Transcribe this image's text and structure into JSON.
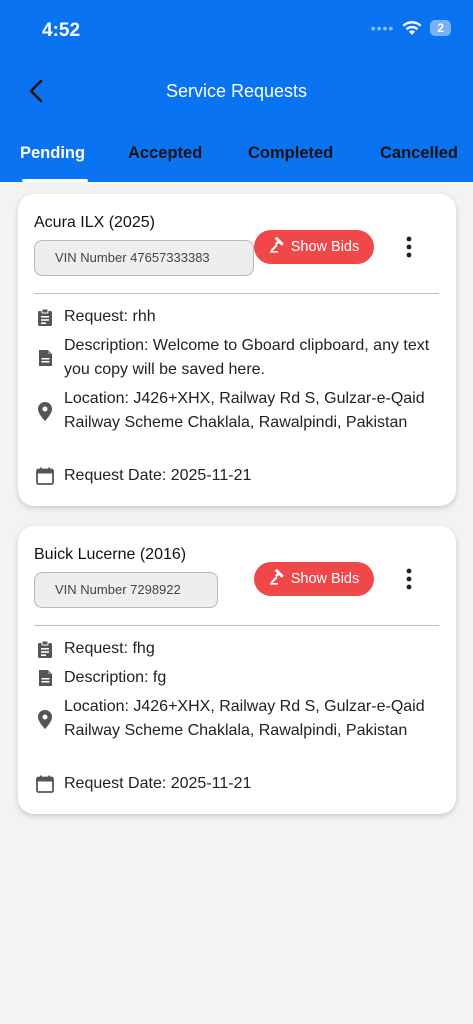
{
  "status_bar": {
    "time": "4:52",
    "signal": "••••",
    "battery": "2"
  },
  "header": {
    "title": "Service Requests"
  },
  "tabs": [
    {
      "label": "Pending"
    },
    {
      "label": "Accepted"
    },
    {
      "label": "Completed"
    },
    {
      "label": "Cancelled"
    }
  ],
  "cards": [
    {
      "car": "Acura ILX (2025)",
      "vin": "VIN Number 47657333383",
      "bids_label": "Show Bids",
      "request": "Request: rhh",
      "description": "Description: Welcome to Gboard clipboard, any text you copy will be saved here.",
      "location": "Location: J426+XHX, Railway Rd S, Gulzar-e-Qaid Railway Scheme Chaklala, Rawalpindi, Pakistan",
      "date": "Request Date: 2025-11-21"
    },
    {
      "car": "Buick Lucerne (2016)",
      "vin": "VIN Number 7298922",
      "bids_label": "Show Bids",
      "request": "Request: fhg",
      "description": "Description: fg",
      "location": "Location: J426+XHX, Railway Rd S, Gulzar-e-Qaid Railway Scheme Chaklala, Rawalpindi, Pakistan",
      "date": "Request Date: 2025-11-21"
    }
  ],
  "colors": {
    "primary": "#0a73f2",
    "bids_button": "#f04848",
    "icon": "#555555"
  }
}
